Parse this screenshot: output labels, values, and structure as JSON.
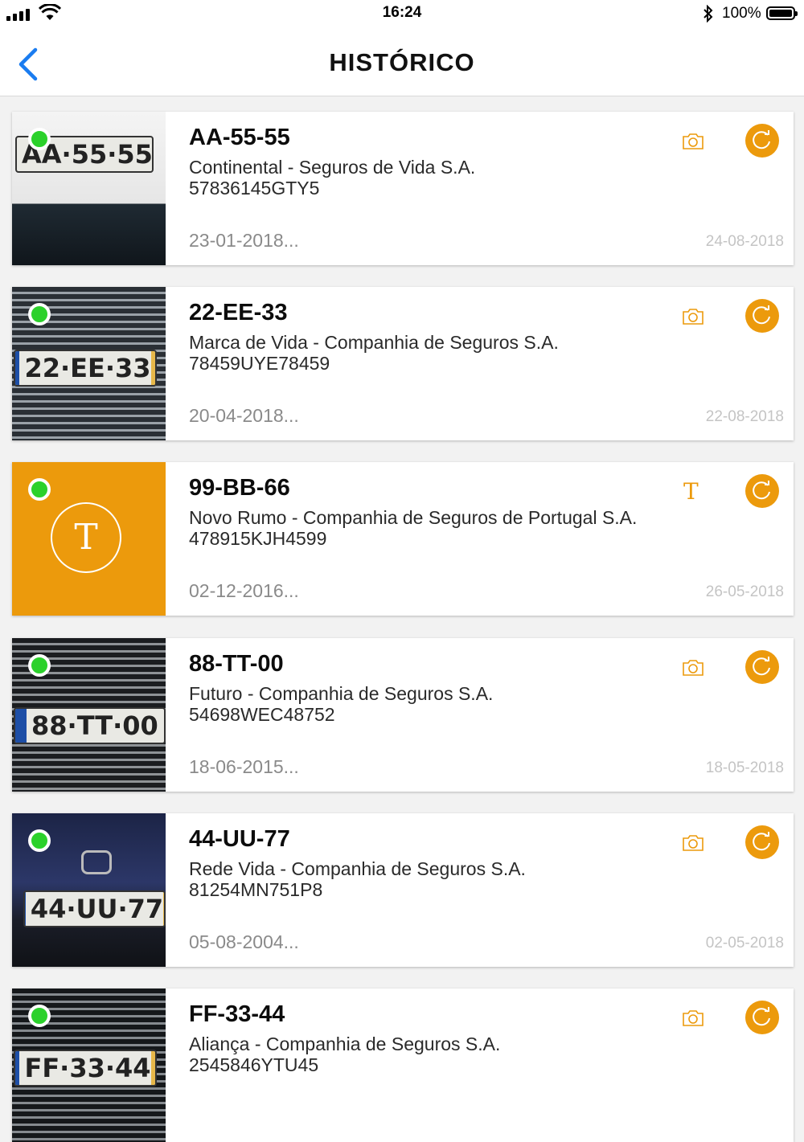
{
  "status_bar": {
    "time": "16:24",
    "battery": "100%"
  },
  "nav": {
    "title": "HISTÓRICO"
  },
  "colors": {
    "accent": "#ec9a0c",
    "active_dot": "#2bd12b",
    "back": "#1a7cf0"
  },
  "records": [
    {
      "plate": "AA-55-55",
      "plate_photo_text": "AA·55·55",
      "insurer": "Continental - Seguros de Vida S.A.",
      "policy": "57836145GTY5",
      "start_date": "23-01-2018...",
      "end_date": "24-08-2018",
      "source": "camera-icon"
    },
    {
      "plate": "22-EE-33",
      "plate_photo_text": "22·EE·33",
      "insurer": "Marca de Vida - Companhia de Seguros S.A.",
      "policy": "78459UYE78459",
      "start_date": "20-04-2018...",
      "end_date": "22-08-2018",
      "source": "camera-icon"
    },
    {
      "plate": "99-BB-66",
      "plate_photo_text": "T",
      "insurer": "Novo Rumo - Companhia de Seguros de Portugal S.A.",
      "policy": "478915KJH4599",
      "start_date": "02-12-2016...",
      "end_date": "26-05-2018",
      "source": "text-icon",
      "source_letter": "T"
    },
    {
      "plate": "88-TT-00",
      "plate_photo_text": "88·TT·00",
      "insurer": "Futuro - Companhia de Seguros S.A.",
      "policy": "54698WEC48752",
      "start_date": "18-06-2015...",
      "end_date": "18-05-2018",
      "source": "camera-icon"
    },
    {
      "plate": "44-UU-77",
      "plate_photo_text": "44·UU·77",
      "insurer": "Rede Vida - Companhia de Seguros S.A.",
      "policy": "81254MN751P8",
      "start_date": "05-08-2004...",
      "end_date": "02-05-2018",
      "source": "camera-icon"
    },
    {
      "plate": "FF-33-44",
      "plate_photo_text": "FF·33·44",
      "insurer": "Aliança - Companhia de Seguros S.A.",
      "policy": "2545846YTU45",
      "start_date": "",
      "end_date": "",
      "source": "camera-icon"
    }
  ]
}
